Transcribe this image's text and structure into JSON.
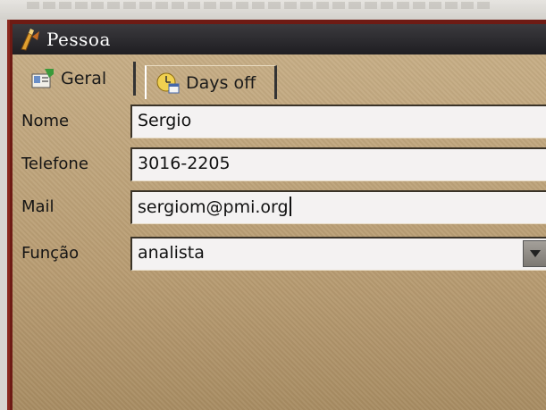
{
  "window": {
    "title": "Pessoa"
  },
  "tabs": [
    {
      "label": "Geral",
      "icon": "contact-card-icon",
      "active": true
    },
    {
      "label": "Days off",
      "icon": "calendar-clock-icon",
      "active": false
    }
  ],
  "form": {
    "nome": {
      "label": "Nome",
      "value": "Sergio"
    },
    "telefone": {
      "label": "Telefone",
      "value": "3016-2205"
    },
    "mail": {
      "label": "Mail",
      "value": "sergiom@pmi.org"
    },
    "funcao": {
      "label": "Função",
      "value": "analista"
    }
  },
  "colors": {
    "window_frame": "#6e1b14",
    "titlebar": "#2b2a2e",
    "client_bg": "#b89c72"
  }
}
